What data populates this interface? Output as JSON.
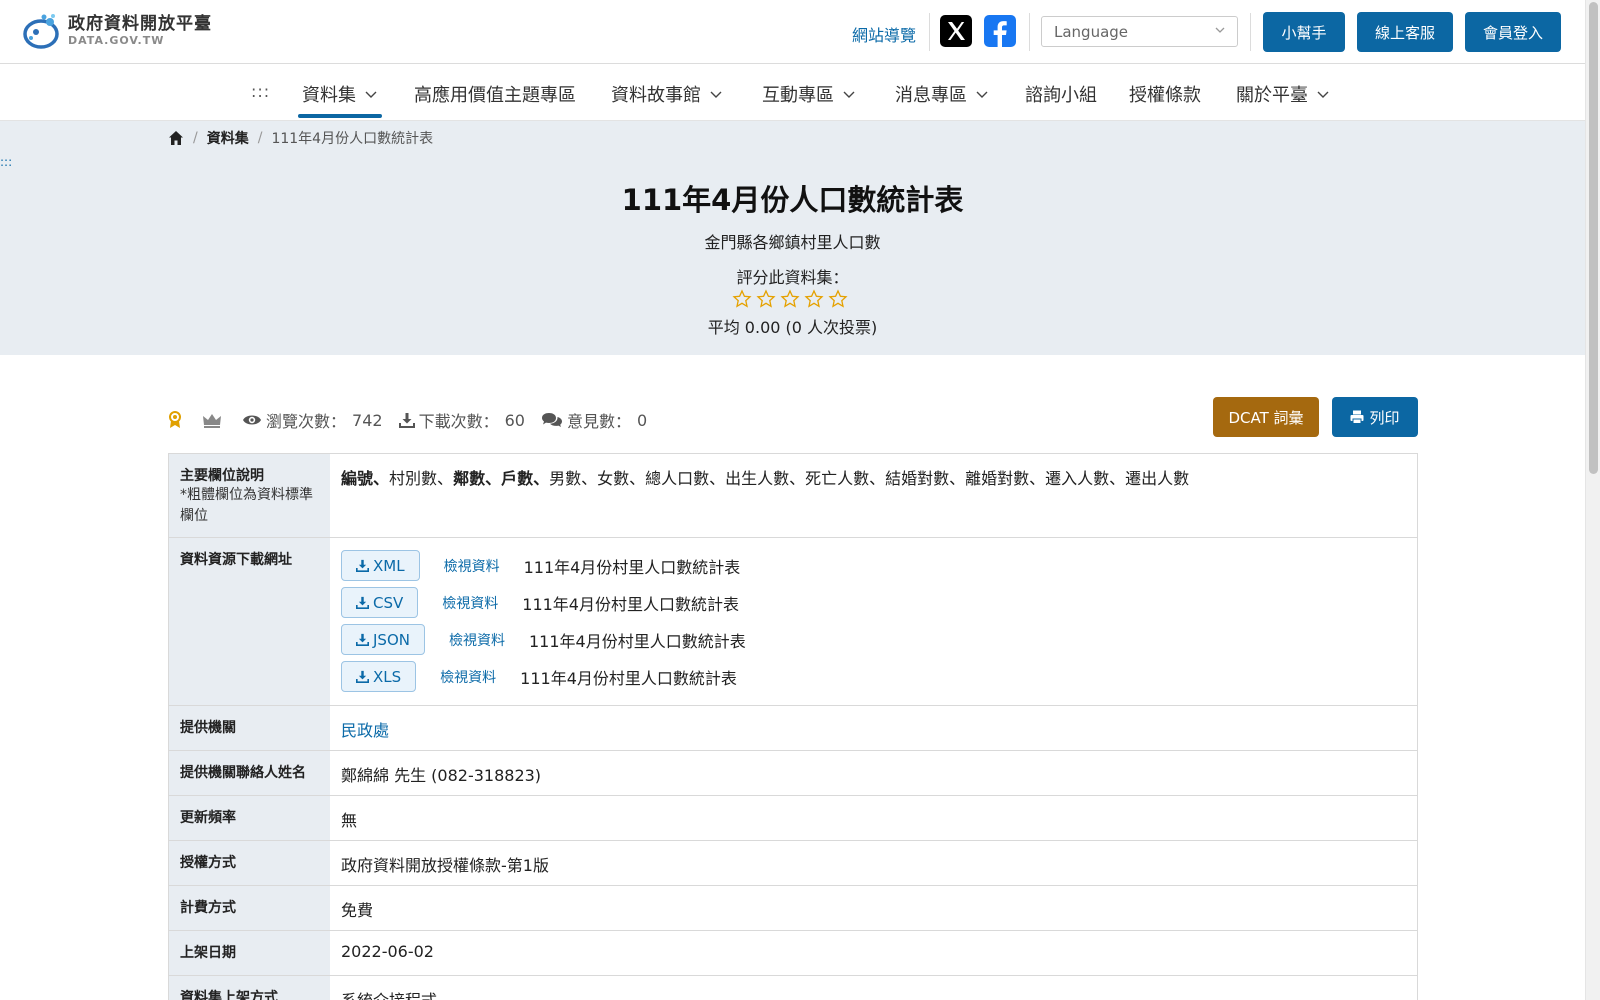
{
  "header": {
    "logo_title": "政府資料開放平臺",
    "logo_sub": "DATA.GOV.TW",
    "sitemap_label": "網站導覽",
    "language_placeholder": "Language",
    "helper_label": "小幫手",
    "service_label": "線上客服",
    "login_label": "會員登入"
  },
  "nav": {
    "dots": ":::",
    "items": [
      {
        "label": "資料集",
        "dropdown": true,
        "active": true
      },
      {
        "label": "高應用價值主題專區",
        "dropdown": false
      },
      {
        "label": "資料故事館",
        "dropdown": true
      },
      {
        "label": "互動專區",
        "dropdown": true
      },
      {
        "label": "消息專區",
        "dropdown": true
      },
      {
        "label": "諮詢小組",
        "dropdown": false
      },
      {
        "label": "授權條款",
        "dropdown": false
      },
      {
        "label": "關於平臺",
        "dropdown": true
      }
    ]
  },
  "breadcrumb": {
    "dataset_label": "資料集",
    "current": "111年4月份人口數統計表"
  },
  "side_dots": ":::",
  "dataset": {
    "title": "111年4月份人口數統計表",
    "subtitle": "金門縣各鄉鎮村里人口數",
    "rate_label": "評分此資料集：",
    "rating_stars": 0,
    "rating_avg": "平均 0.00 (0 人次投票)"
  },
  "stats": {
    "views_label": "瀏覽次數：",
    "views": "742",
    "downloads_label": "下載次數：",
    "downloads": "60",
    "comments_label": "意見數：",
    "comments": "0"
  },
  "actions": {
    "dcat_label": "DCAT 詞彙",
    "print_label": "列印"
  },
  "details": {
    "fields_label": "主要欄位說明",
    "fields_note": "*粗體欄位為資料標準欄位",
    "fields_bold": [
      "編號",
      "鄰數",
      "戶數"
    ],
    "fields_text": {
      "f1": "編號",
      "f2": "村別數",
      "f3": "鄰數",
      "f4": "戶數",
      "rest": "男數、女數、總人口數、出生人數、死亡人數、結婚對數、離婚對數、遷入人數、遷出人數"
    },
    "resources_label": "資料資源下載網址",
    "resources": [
      {
        "format": "XML",
        "view": "檢視資料",
        "name": "111年4月份村里人口數統計表"
      },
      {
        "format": "CSV",
        "view": "檢視資料",
        "name": "111年4月份村里人口數統計表"
      },
      {
        "format": "JSON",
        "view": "檢視資料",
        "name": "111年4月份村里人口數統計表"
      },
      {
        "format": "XLS",
        "view": "檢視資料",
        "name": "111年4月份村里人口數統計表"
      }
    ],
    "provider_label": "提供機關",
    "provider": "民政處",
    "contact_label": "提供機關聯絡人姓名",
    "contact": "鄭綿綿 先生 (082-318823)",
    "frequency_label": "更新頻率",
    "frequency": "無",
    "license_label": "授權方式",
    "license": "政府資料開放授權條款-第1版",
    "fee_label": "計費方式",
    "fee": "免費",
    "date_label": "上架日期",
    "date": "2022-06-02",
    "method_label": "資料集上架方式",
    "method": "系統介接程式"
  },
  "colors": {
    "primary": "#0c67a3",
    "dcat": "#a5690f",
    "hero_bg": "#e8edf2",
    "star": "#e5a100"
  }
}
